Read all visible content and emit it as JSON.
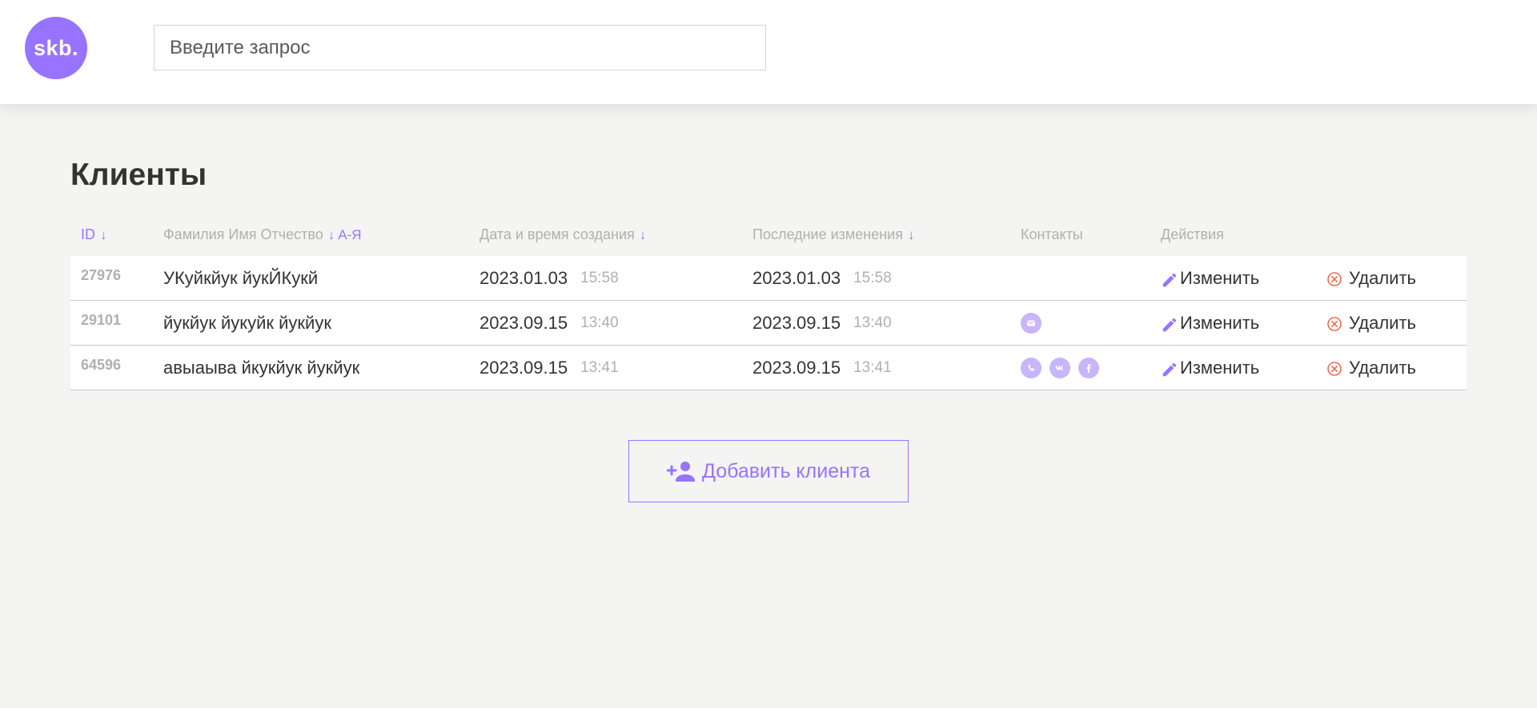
{
  "header": {
    "logo_text": "skb.",
    "search_placeholder": "Введите запрос"
  },
  "page_title": "Клиенты",
  "columns": {
    "id": "ID",
    "name": "Фамилия Имя Отчество",
    "name_sort": "А-Я",
    "created": "Дата и время создания",
    "updated": "Последние изменения",
    "contacts": "Контакты",
    "actions": "Действия",
    "sort_arrow": "↓"
  },
  "rows": [
    {
      "id": "27976",
      "name": "УКуйкйук йукЙКукй",
      "created_date": "2023.01.03",
      "created_time": "15:58",
      "updated_date": "2023.01.03",
      "updated_time": "15:58",
      "contacts": []
    },
    {
      "id": "29101",
      "name": "йукйук йукуйк йукйук",
      "created_date": "2023.09.15",
      "created_time": "13:40",
      "updated_date": "2023.09.15",
      "updated_time": "13:40",
      "contacts": [
        "mail-icon"
      ]
    },
    {
      "id": "64596",
      "name": "авыаыва йкукйук йукйук",
      "created_date": "2023.09.15",
      "created_time": "13:41",
      "updated_date": "2023.09.15",
      "updated_time": "13:41",
      "contacts": [
        "phone-icon",
        "vk-icon",
        "facebook-icon"
      ]
    }
  ],
  "actions": {
    "edit_label": "Изменить",
    "delete_label": "Удалить"
  },
  "add_button_label": "Добавить клиента",
  "colors": {
    "accent": "#9873ff",
    "contact_icon": "#c8b5fb",
    "delete_icon": "#f06a4d",
    "background": "#f4f4f2"
  }
}
